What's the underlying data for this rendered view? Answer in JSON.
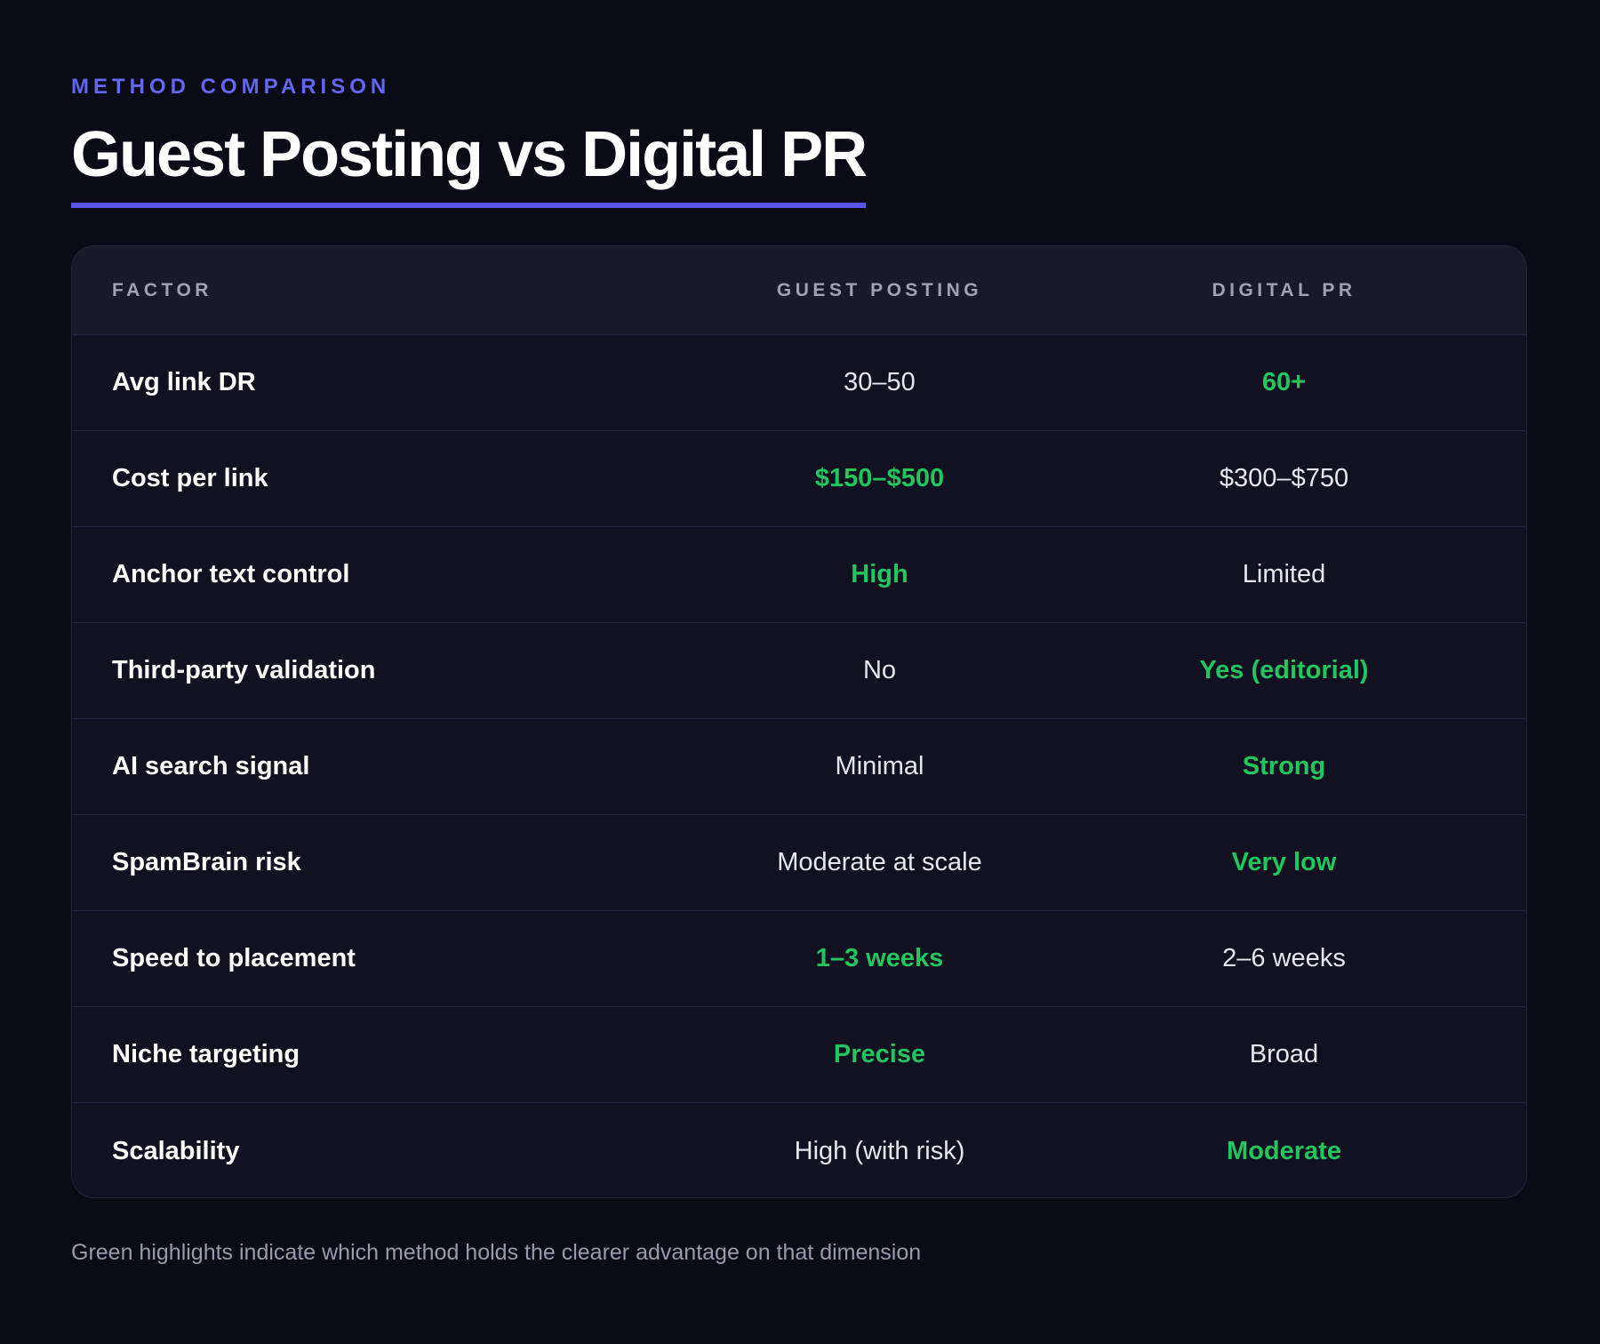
{
  "eyebrow": "METHOD COMPARISON",
  "title": "Guest Posting vs Digital PR",
  "colors": {
    "background": "#0b0b18",
    "accent": "#6366f1",
    "highlight": "#22c55e"
  },
  "table": {
    "headers": [
      "FACTOR",
      "GUEST POSTING",
      "DIGITAL PR"
    ],
    "rows": [
      {
        "factor": "Avg link DR",
        "guest": "30–50",
        "pr": "60+",
        "winner": "pr"
      },
      {
        "factor": "Cost per link",
        "guest": "$150–$500",
        "pr": "$300–$750",
        "winner": "guest"
      },
      {
        "factor": "Anchor text control",
        "guest": "High",
        "pr": "Limited",
        "winner": "guest"
      },
      {
        "factor": "Third-party validation",
        "guest": "No",
        "pr": "Yes (editorial)",
        "winner": "pr"
      },
      {
        "factor": "AI search signal",
        "guest": "Minimal",
        "pr": "Strong",
        "winner": "pr"
      },
      {
        "factor": "SpamBrain risk",
        "guest": "Moderate at scale",
        "pr": "Very low",
        "winner": "pr"
      },
      {
        "factor": "Speed to placement",
        "guest": "1–3 weeks",
        "pr": "2–6 weeks",
        "winner": "guest"
      },
      {
        "factor": "Niche targeting",
        "guest": "Precise",
        "pr": "Broad",
        "winner": "guest"
      },
      {
        "factor": "Scalability",
        "guest": "High (with risk)",
        "pr": "Moderate",
        "winner": "pr"
      }
    ]
  },
  "footnote": "Green highlights indicate which method holds the clearer advantage on that dimension"
}
